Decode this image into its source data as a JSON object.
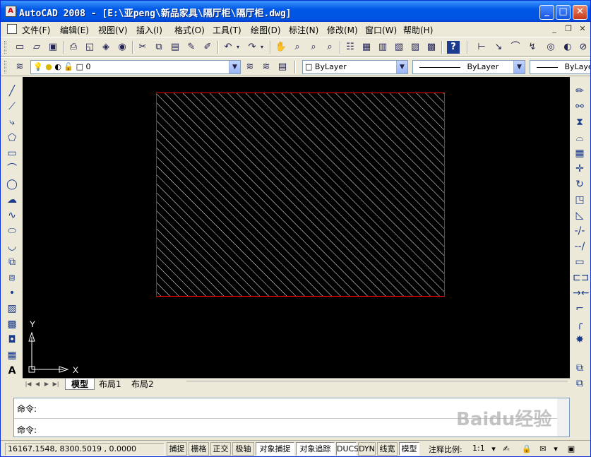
{
  "window": {
    "title": "AutoCAD 2008 - [E:\\亚peng\\新品家具\\隔厅柜\\隔厅柜.dwg]",
    "app_icon": "autocad-logo-icon",
    "buttons": [
      "minimize",
      "maximize",
      "close"
    ]
  },
  "menu": {
    "items": [
      "文件(F)",
      "编辑(E)",
      "视图(V)",
      "插入(I)",
      "格式(O)",
      "工具(T)",
      "绘图(D)",
      "标注(N)",
      "修改(M)",
      "窗口(W)",
      "帮助(H)"
    ]
  },
  "layers_toolbar": {
    "layer_value": "0",
    "color_value": "ByLayer",
    "linetype_value": "ByLayer",
    "lineweight_value": "ByLayer"
  },
  "drawing": {
    "hatch_color": "#ffffff",
    "border_color": "#ff0000",
    "ucs": {
      "x_label": "X",
      "y_label": "Y"
    }
  },
  "tabs": {
    "items": [
      "模型",
      "布局1",
      "布局2"
    ],
    "active": "模型"
  },
  "command": {
    "line1": "命令:",
    "line2": "命令:"
  },
  "status": {
    "coords": "16167.1548, 8300.5019 , 0.0000",
    "buttons": [
      {
        "label": "捕捉",
        "on": false
      },
      {
        "label": "栅格",
        "on": false
      },
      {
        "label": "正交",
        "on": false
      },
      {
        "label": "极轴",
        "on": false
      },
      {
        "label": "对象捕捉",
        "on": true
      },
      {
        "label": "对象追踪",
        "on": true
      },
      {
        "label": "DUCS",
        "on": true
      },
      {
        "label": "DYN",
        "on": false
      },
      {
        "label": "线宽",
        "on": false
      },
      {
        "label": "模型",
        "on": true
      }
    ],
    "annotation_scale_label": "注释比例:",
    "annotation_scale_value": "1:1"
  },
  "watermark": {
    "text": "Baidu经验"
  },
  "colors": {
    "titlebar": "#0054e3",
    "canvas_bg": "#000000",
    "chrome": "#ece9d8"
  }
}
